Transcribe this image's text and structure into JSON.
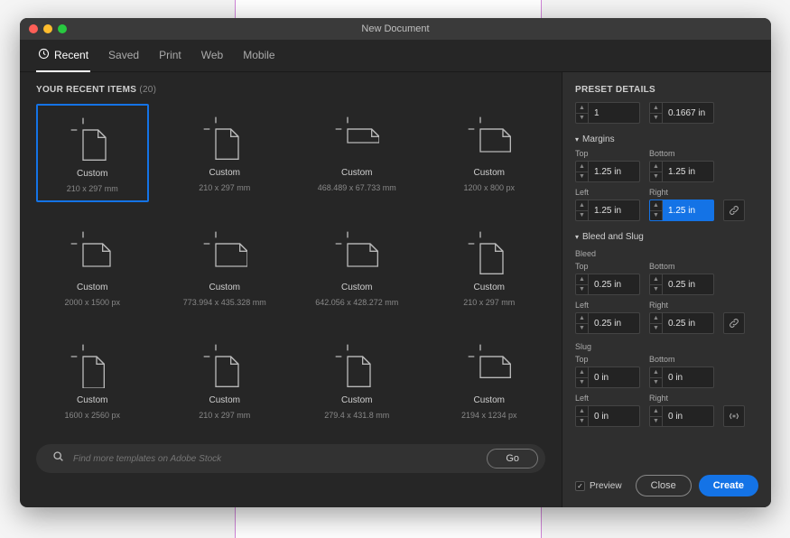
{
  "window": {
    "title": "New Document"
  },
  "tabs": [
    {
      "label": "Recent",
      "active": true,
      "icon": "clock-icon"
    },
    {
      "label": "Saved"
    },
    {
      "label": "Print"
    },
    {
      "label": "Web"
    },
    {
      "label": "Mobile"
    }
  ],
  "recent": {
    "heading": "YOUR RECENT ITEMS",
    "count": "(20)",
    "items": [
      {
        "title": "Custom",
        "dims": "210 x 297 mm",
        "selected": true
      },
      {
        "title": "Custom",
        "dims": "210 x 297 mm"
      },
      {
        "title": "Custom",
        "dims": "468.489 x 67.733 mm"
      },
      {
        "title": "Custom",
        "dims": "1200 x 800 px"
      },
      {
        "title": "Custom",
        "dims": "2000 x 1500 px"
      },
      {
        "title": "Custom",
        "dims": "773.994 x 435.328 mm"
      },
      {
        "title": "Custom",
        "dims": "642.056 x 428.272 mm"
      },
      {
        "title": "Custom",
        "dims": "210 x 297 mm"
      },
      {
        "title": "Custom",
        "dims": "1600 x 2560 px"
      },
      {
        "title": "Custom",
        "dims": "210 x 297 mm"
      },
      {
        "title": "Custom",
        "dims": "279.4 x 431.8 mm"
      },
      {
        "title": "Custom",
        "dims": "2194 x 1234 px"
      }
    ]
  },
  "search": {
    "placeholder": "Find more templates on Adobe Stock",
    "go": "Go"
  },
  "details": {
    "heading": "PRESET DETAILS",
    "top_row": {
      "a": "1",
      "b": "0.1667 in"
    },
    "margins": {
      "heading": "Margins",
      "top_label": "Top",
      "top": "1.25 in",
      "bottom_label": "Bottom",
      "bottom": "1.25 in",
      "left_label": "Left",
      "left": "1.25 in",
      "right_label": "Right",
      "right": "1.25 in"
    },
    "bleedslug": {
      "heading": "Bleed and Slug",
      "bleed_label": "Bleed",
      "slug_label": "Slug",
      "top_label": "Top",
      "bottom_label": "Bottom",
      "left_label": "Left",
      "right_label": "Right",
      "bleed": {
        "top": "0.25 in",
        "bottom": "0.25 in",
        "left": "0.25 in",
        "right": "0.25 in"
      },
      "slug": {
        "top": "0 in",
        "bottom": "0 in",
        "left": "0 in",
        "right": "0 in"
      }
    },
    "preview_label": "Preview",
    "preview_checked": true,
    "close": "Close",
    "create": "Create"
  }
}
